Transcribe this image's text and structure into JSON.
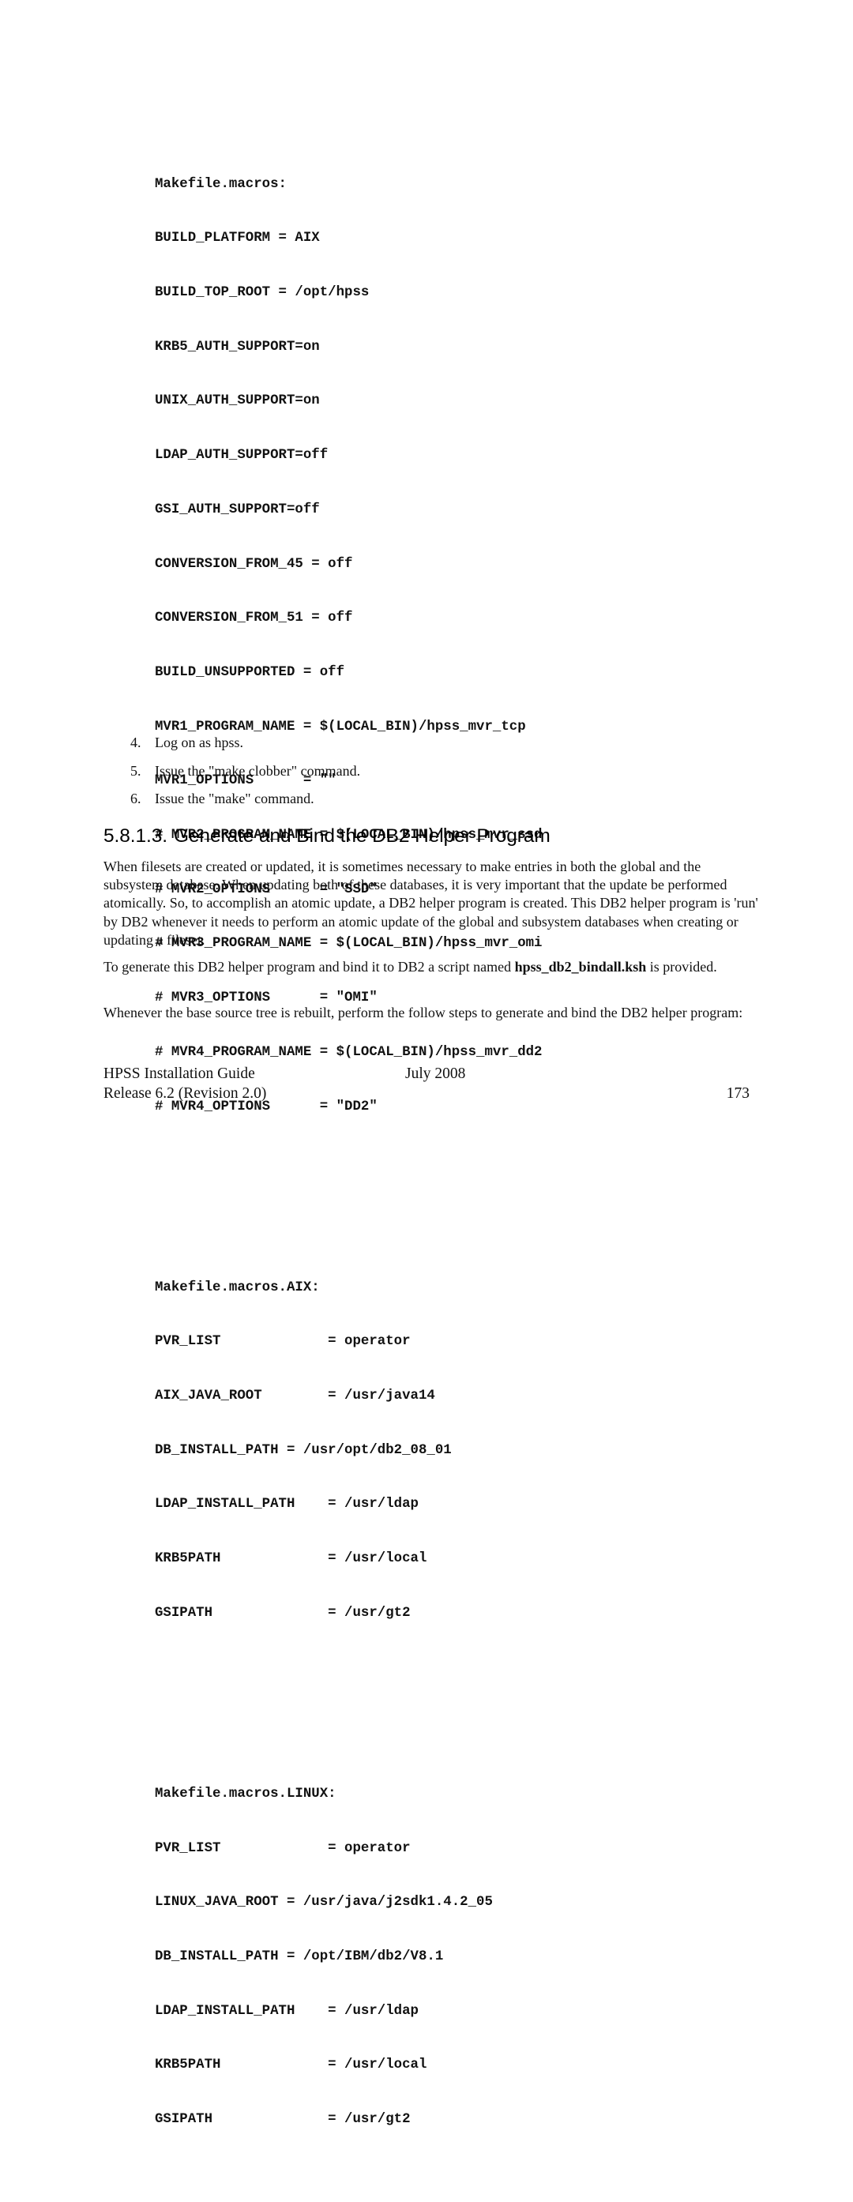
{
  "code": {
    "sections": [
      {
        "lines": [
          "Makefile.macros:",
          "BUILD_PLATFORM = AIX",
          "BUILD_TOP_ROOT = /opt/hpss",
          "KRB5_AUTH_SUPPORT=on",
          "UNIX_AUTH_SUPPORT=on",
          "LDAP_AUTH_SUPPORT=off",
          "GSI_AUTH_SUPPORT=off",
          "CONVERSION_FROM_45 = off",
          "CONVERSION_FROM_51 = off",
          "BUILD_UNSUPPORTED = off",
          "MVR1_PROGRAM_NAME = $(LOCAL_BIN)/hpss_mvr_tcp",
          "MVR1_OPTIONS      = \"\"",
          "# MVR2_PROGRAM_NAME = $(LOCAL_BIN)/hpss_mvr_ssd",
          "# MVR2_OPTIONS      = \"SSD\"",
          "# MVR3_PROGRAM_NAME = $(LOCAL_BIN)/hpss_mvr_omi",
          "# MVR3_OPTIONS      = \"OMI\"",
          "# MVR4_PROGRAM_NAME = $(LOCAL_BIN)/hpss_mvr_dd2",
          "# MVR4_OPTIONS      = \"DD2\""
        ]
      },
      {
        "lines": [
          "Makefile.macros.AIX:",
          "PVR_LIST             = operator",
          "AIX_JAVA_ROOT        = /usr/java14",
          "DB_INSTALL_PATH = /usr/opt/db2_08_01",
          "LDAP_INSTALL_PATH    = /usr/ldap",
          "KRB5PATH             = /usr/local",
          "GSIPATH              = /usr/gt2"
        ]
      },
      {
        "lines": [
          "Makefile.macros.LINUX:",
          "PVR_LIST             = operator",
          "LINUX_JAVA_ROOT = /usr/java/j2sdk1.4.2_05",
          "DB_INSTALL_PATH = /opt/IBM/db2/V8.1",
          "LDAP_INSTALL_PATH    = /usr/ldap",
          "KRB5PATH             = /usr/local",
          "GSIPATH              = /usr/gt2"
        ]
      }
    ]
  },
  "steps": [
    {
      "num": "4.",
      "text": "Log on as hpss."
    },
    {
      "num": "5.",
      "text": "Issue the \"make clobber\" command."
    },
    {
      "num": "6.",
      "text": "Issue the \"make\" command."
    }
  ],
  "section": {
    "number": "5.8.1.3.",
    "title": "Generate and Bind the DB2 Helper Program"
  },
  "paragraphs": {
    "p1": "When filesets are created or updated, it is sometimes necessary to make entries in both the global and the subsystem database. When updating both of these databases, it is very important that the update be performed atomically. So, to accomplish an atomic update, a DB2 helper program is created. This DB2 helper program is 'run' by DB2 whenever it needs to perform an atomic update of the global and subsystem databases when creating or updating a fileset.",
    "p2_before": "To generate this DB2 helper program and bind it to DB2 a script named ",
    "p2_bold": "hpss_db2_bindall.ksh",
    "p2_after": " is provided.",
    "p3": "Whenever the base source tree is rebuilt, perform the follow steps to generate and bind the DB2 helper program:"
  },
  "footer": {
    "guide_title": "HPSS Installation Guide",
    "date": "July 2008",
    "release": "Release 6.2 (Revision 2.0)",
    "page_number": "173"
  }
}
